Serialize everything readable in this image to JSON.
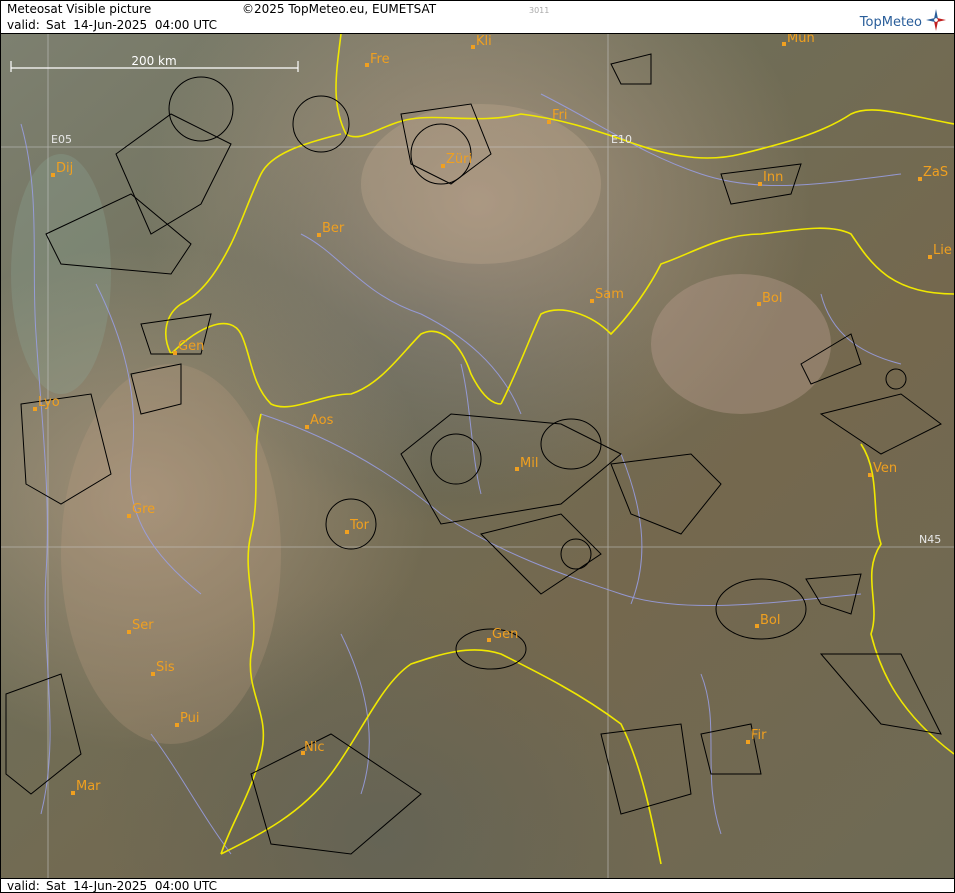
{
  "header": {
    "product": "Meteosat Visible picture",
    "copyright": "©2025 TopMeteo.eu, EUMETSAT",
    "code": "3011",
    "brand": "TopMeteo",
    "valid_label": "valid:",
    "valid_time": "Sat  14-Jun-2025  04:00 UTC"
  },
  "footer": {
    "valid_label": "valid:",
    "valid_time": "Sat  14-Jun-2025  04:00 UTC"
  },
  "scale_bar": {
    "label": "200 km"
  },
  "grid_labels": [
    "E05",
    "E10",
    "N45"
  ],
  "cities": [
    "Mün",
    "Fre",
    "Kli",
    "Fri",
    "Züri",
    "Inn",
    "ZaS",
    "Dij",
    "Ber",
    "Lie",
    "Sam",
    "Bol",
    "Gen",
    "Lyo",
    "Aos",
    "Mil",
    "Ven",
    "Gre",
    "Tor",
    "Ser",
    "Gen",
    "Bol",
    "Sis",
    "Pui",
    "Nic",
    "Fir",
    "Mar"
  ],
  "colors": {
    "border": "#e8e000",
    "city_label": "#f0a020",
    "river": "#9aa0e8",
    "airspace": "#000000",
    "grid": "#c8c8c8"
  }
}
